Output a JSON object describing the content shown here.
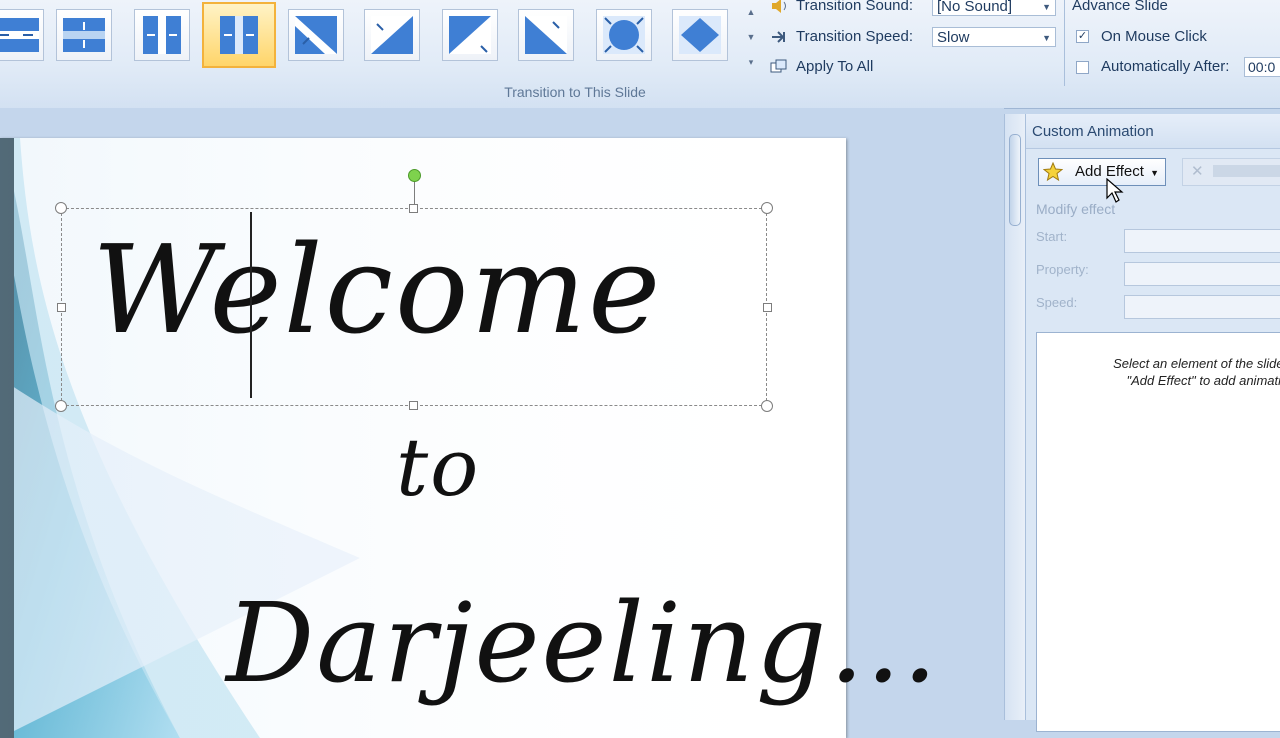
{
  "ribbon": {
    "transitions": [
      {
        "name": "split-vertical-in-partial",
        "selected": false
      },
      {
        "name": "split-horizontal-out",
        "selected": false
      },
      {
        "name": "split-vertical-in",
        "selected": false
      },
      {
        "name": "split-vertical-out",
        "selected": true
      },
      {
        "name": "strips-left-down",
        "selected": false
      },
      {
        "name": "strips-left-up",
        "selected": false
      },
      {
        "name": "strips-right-down",
        "selected": false
      },
      {
        "name": "strips-right-up",
        "selected": false
      },
      {
        "name": "shape-circle",
        "selected": false
      },
      {
        "name": "shape-diamond",
        "selected": false
      }
    ],
    "group_label": "Transition to This Slide",
    "sound_label": "Transition Sound:",
    "sound_value": "[No Sound]",
    "speed_label": "Transition Speed:",
    "speed_value": "Slow",
    "apply_all_label": "Apply To All",
    "advance": {
      "title": "Advance Slide",
      "on_click_label": "On Mouse Click",
      "on_click_checked": true,
      "auto_label": "Automatically After:",
      "auto_checked": false,
      "auto_value": "00:0"
    }
  },
  "slide": {
    "line1": "Welcome",
    "line2": "to",
    "line3": "Darjeeling…"
  },
  "task_pane": {
    "title": "Custom Animation",
    "add_effect_label": "Add Effect",
    "modify_label": "Modify effect",
    "start_label": "Start:",
    "property_label": "Property:",
    "speed_label": "Speed:",
    "hint_line1": "Select an element of the slide, the",
    "hint_line2": "\"Add Effect\" to add animation"
  },
  "colors": {
    "accent": "#f3b23c",
    "ribbon_text": "#1e3a5f",
    "workspace": "#c4d6ec"
  }
}
